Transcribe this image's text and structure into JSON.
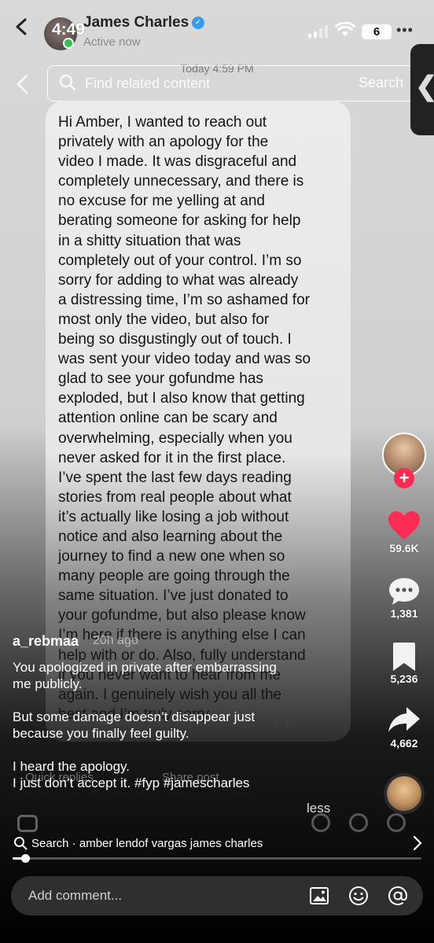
{
  "status_bar": {
    "time": "4:49",
    "battery": "6"
  },
  "dm": {
    "name": "James Charles",
    "status": "Active now",
    "timestamp": "Today 4:59 PM",
    "message": "Hi Amber, I wanted to reach out\nprivately with an apology for the\nvideo I made. It was disgraceful and\ncompletely unnecessary, and there is\nno excuse for me yelling at and\nberating someone for asking for help\nin a shitty situation that was\ncompletely out of your control. I’m so\nsorry for adding to what was already\na distressing time, I’m so ashamed for\nmost only the video, but also for\nbeing so disgustingly out of touch. I\nwas sent your video today and was so\nglad to see your gofundme has\nexploded, but I also know that getting\nattention online can be scary and\noverwhelming, especially when you\nnever asked for it in the first place.\nI’ve spent the last few days reading\nstories from real people about what\nit’s actually like losing a job without\nnotice and also learning about the\njourney to find a new one when so\nmany people are going through the\nsame situation. I’ve just donated to\nyour gofundme, but also please know\nI’m here if there is anything else I can\nhelp with or do. Also, fully understand\nif you never want to hear from me\nagain. I genuinely wish you all the\nbest and I’m truly sorry.",
    "quick_reply": "Quick replies",
    "share_post": "Share post"
  },
  "search": {
    "placeholder": "Find related content",
    "button": "Search"
  },
  "actions": {
    "likes": "59.6K",
    "comments": "1,381",
    "saves": "5,236",
    "shares": "4,662"
  },
  "post": {
    "username": "a_rebmaa",
    "posted": "20h ago",
    "caption": "You apologized in private after embarrassing\nme  publicly.\n\nBut some damage doesn’t disappear just\nbecause you finally feel guilty.\n\nI heard the apology.\nI just don’t accept it.  #fyp #jamescharles",
    "less": "less"
  },
  "suggestion": {
    "text": "Search · amber lendof vargas james charles"
  },
  "playback": {
    "progress": 0.03
  },
  "comment": {
    "placeholder": "Add comment..."
  },
  "colors": {
    "like": "#fe2c55",
    "follow": "#fe2c55",
    "online": "#2fc24a"
  },
  "icons": [
    "back-icon",
    "search-icon",
    "heart-icon",
    "comment-icon",
    "bookmark-icon",
    "share-icon",
    "image-icon",
    "emoji-icon",
    "mention-icon",
    "chevron-right-icon"
  ]
}
